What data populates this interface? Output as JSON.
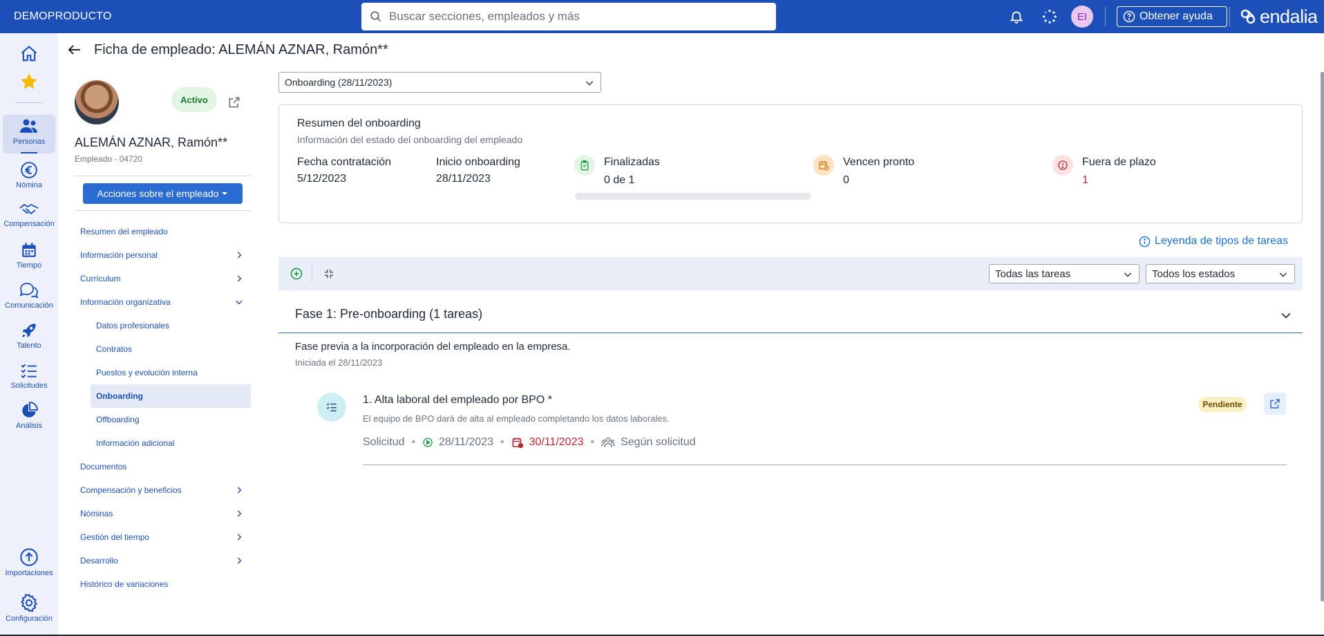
{
  "topbar": {
    "brand": "DEMOPRODUCTO",
    "search_placeholder": "Buscar secciones, empleados y más",
    "user_initials": "EI",
    "help_label": "Obtener ayuda",
    "logo_text": "endalia"
  },
  "leftnav": {
    "items": [
      {
        "icon": "home-icon",
        "label": ""
      },
      {
        "icon": "star-icon",
        "label": ""
      },
      {
        "icon": "people-icon",
        "label": "Personas"
      },
      {
        "icon": "euro-icon",
        "label": "Nómina"
      },
      {
        "icon": "handshake-icon",
        "label": "Compensación"
      },
      {
        "icon": "calendar-icon",
        "label": "Tiempo"
      },
      {
        "icon": "chat-icon",
        "label": "Comunicación"
      },
      {
        "icon": "rocket-icon",
        "label": "Talento"
      },
      {
        "icon": "checklist-icon",
        "label": "Solicitudes"
      },
      {
        "icon": "pie-icon",
        "label": "Análisis"
      },
      {
        "icon": "upload-icon",
        "label": "Importaciones"
      },
      {
        "icon": "gear-icon",
        "label": "Configuración"
      }
    ]
  },
  "page": {
    "title": "Ficha de empleado: ALEMÁN AZNAR, Ramón**"
  },
  "employee": {
    "status": "Activo",
    "name": "ALEMÁN AZNAR, Ramón**",
    "subtitle": "Empleado - 04720",
    "actions_label": "Acciones sobre el empleado"
  },
  "menu": {
    "items": [
      {
        "label": "Resumen del empleado"
      },
      {
        "label": "Información personal"
      },
      {
        "label": "Currículum"
      },
      {
        "label": "Información organizativa"
      },
      {
        "label": "Datos profesionales"
      },
      {
        "label": "Contratos"
      },
      {
        "label": "Puestos y evolución interna"
      },
      {
        "label": "Onboarding"
      },
      {
        "label": "Offboarding"
      },
      {
        "label": "Información adicional"
      },
      {
        "label": "Documentos"
      },
      {
        "label": "Compensación y beneficios"
      },
      {
        "label": "Nóminas"
      },
      {
        "label": "Gestión del tiempo"
      },
      {
        "label": "Desarrollo"
      },
      {
        "label": "Histórico de variaciones"
      }
    ]
  },
  "onboarding": {
    "selected": "Onboarding (28/11/2023)",
    "summary_title": "Resumen del onboarding",
    "summary_sub": "Información del estado del onboarding del empleado",
    "hire_label": "Fecha contratación",
    "hire_value": "5/12/2023",
    "start_label": "Inicio onboarding",
    "start_value": "28/11/2023",
    "done_label": "Finalizadas",
    "done_value": "0 de 1",
    "done_progress": 0,
    "due_label": "Vencen pronto",
    "due_value": "0",
    "late_label": "Fuera de plazo",
    "late_value": "1",
    "colors": {
      "accent": "#1c4fb8",
      "danger": "#c0262d",
      "success": "#22c55e",
      "warning": "#f59e0b"
    }
  },
  "legend_link": "Leyenda de tipos de tareas",
  "filters": {
    "tasks": "Todas las tareas",
    "states": "Todos los estados"
  },
  "phase": {
    "title": "Fase 1: Pre-onboarding (1 tareas)",
    "description": "Fase previa a la incorporación del empleado en la empresa.",
    "started": "Iniciada el 28/11/2023"
  },
  "task": {
    "title": "1. Alta laboral del empleado por BPO *",
    "description": "El equipo de BPO dará de alta al empleado completando los datos laborales.",
    "type": "Solicitud",
    "start": "28/11/2023",
    "due": "30/11/2023",
    "assignee": "Según solicitud",
    "status": "Pendiente"
  }
}
